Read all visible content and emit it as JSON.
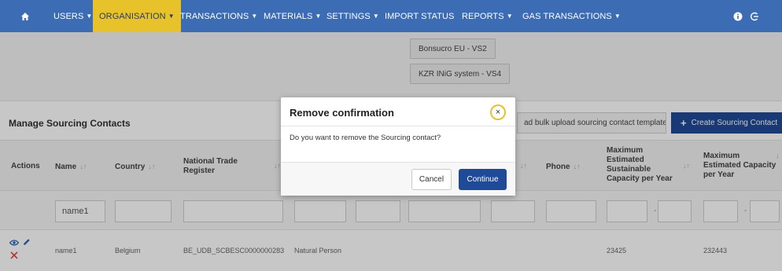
{
  "nav": {
    "items": [
      {
        "label": "USERS"
      },
      {
        "label": "ORGANISATION"
      },
      {
        "label": "TRANSACTIONS"
      },
      {
        "label": "MATERIALS"
      },
      {
        "label": "SETTINGS"
      },
      {
        "label": "IMPORT STATUS"
      },
      {
        "label": "REPORTS"
      },
      {
        "label": "GAS TRANSACTIONS"
      }
    ],
    "active_item": "ORGANISATION",
    "icons": [
      "home-icon",
      "info-icon",
      "logout-icon"
    ]
  },
  "schemes": {
    "items": [
      "Bonsucro EU - VS2",
      "KZR INiG system - VS4"
    ]
  },
  "section": {
    "title": "Manage Sourcing Contacts",
    "download_template_label": "ad bulk upload sourcing contact template",
    "create_label": "Create Sourcing Contact"
  },
  "table": {
    "headers": {
      "actions": "Actions",
      "name": "Name",
      "country": "Country",
      "ntr": "National Trade Register",
      "phone": "Phone",
      "max_est_sust": "Maximum Estimated Sustainable Capacity per Year",
      "max_est": "Maximum Estimated Capacity per Year"
    },
    "filters": {
      "name": "name1",
      "range_separator": "-"
    },
    "rows": [
      {
        "name": "name1",
        "country": "Belgium",
        "ntr": "BE_UDB_SCBESC0000000283",
        "type": "Natural Person",
        "max_est_sust": "23425",
        "max_est": "232443"
      }
    ]
  },
  "modal": {
    "title": "Remove confirmation",
    "body": "Do you want to remove the Sourcing contact?",
    "cancel_label": "Cancel",
    "continue_label": "Continue",
    "close_symbol": "×"
  },
  "colors": {
    "nav_bg": "#3b6cb4",
    "nav_active": "#e8c22a",
    "primary_button": "#1f4a98",
    "delete_icon": "#d9342b",
    "view_icon": "#2f66b8"
  }
}
